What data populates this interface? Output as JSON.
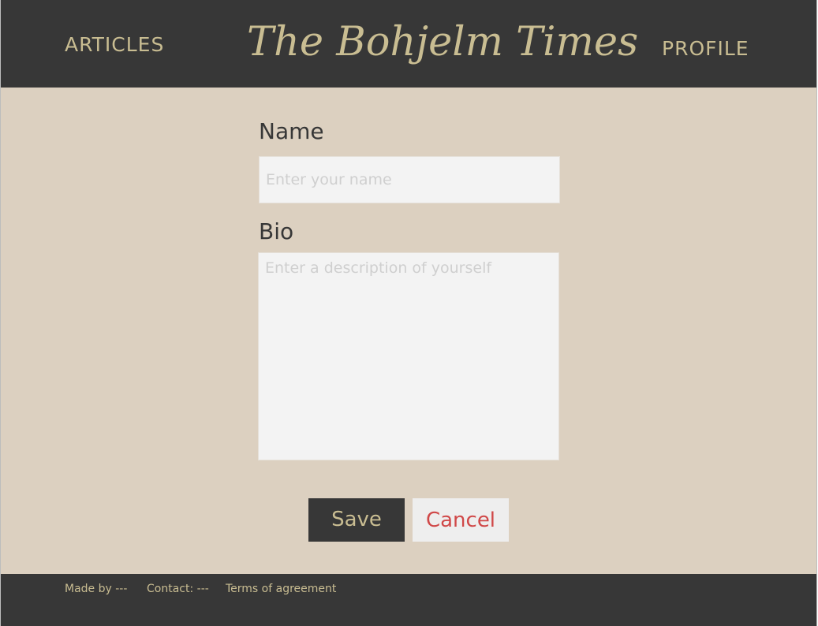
{
  "header": {
    "logo_text": "The Bohjelm Times",
    "nav_articles": "ARTICLES",
    "nav_profile": "PROFILE"
  },
  "form": {
    "name_label": "Name",
    "name_placeholder": "Enter your name",
    "name_value": "",
    "bio_label": "Bio",
    "bio_placeholder": "Enter a description of yourself",
    "bio_value": "",
    "save_label": "Save",
    "cancel_label": "Cancel"
  },
  "footer": {
    "made_by": "Made by ---",
    "contact": "Contact: ---",
    "terms": "Terms of agreement"
  },
  "colors": {
    "header_bg": "#373737",
    "page_bg": "#dcd0c0",
    "accent_gold": "#c9bd92",
    "cancel_red": "#d04848",
    "field_bg": "#f3f3f3"
  }
}
